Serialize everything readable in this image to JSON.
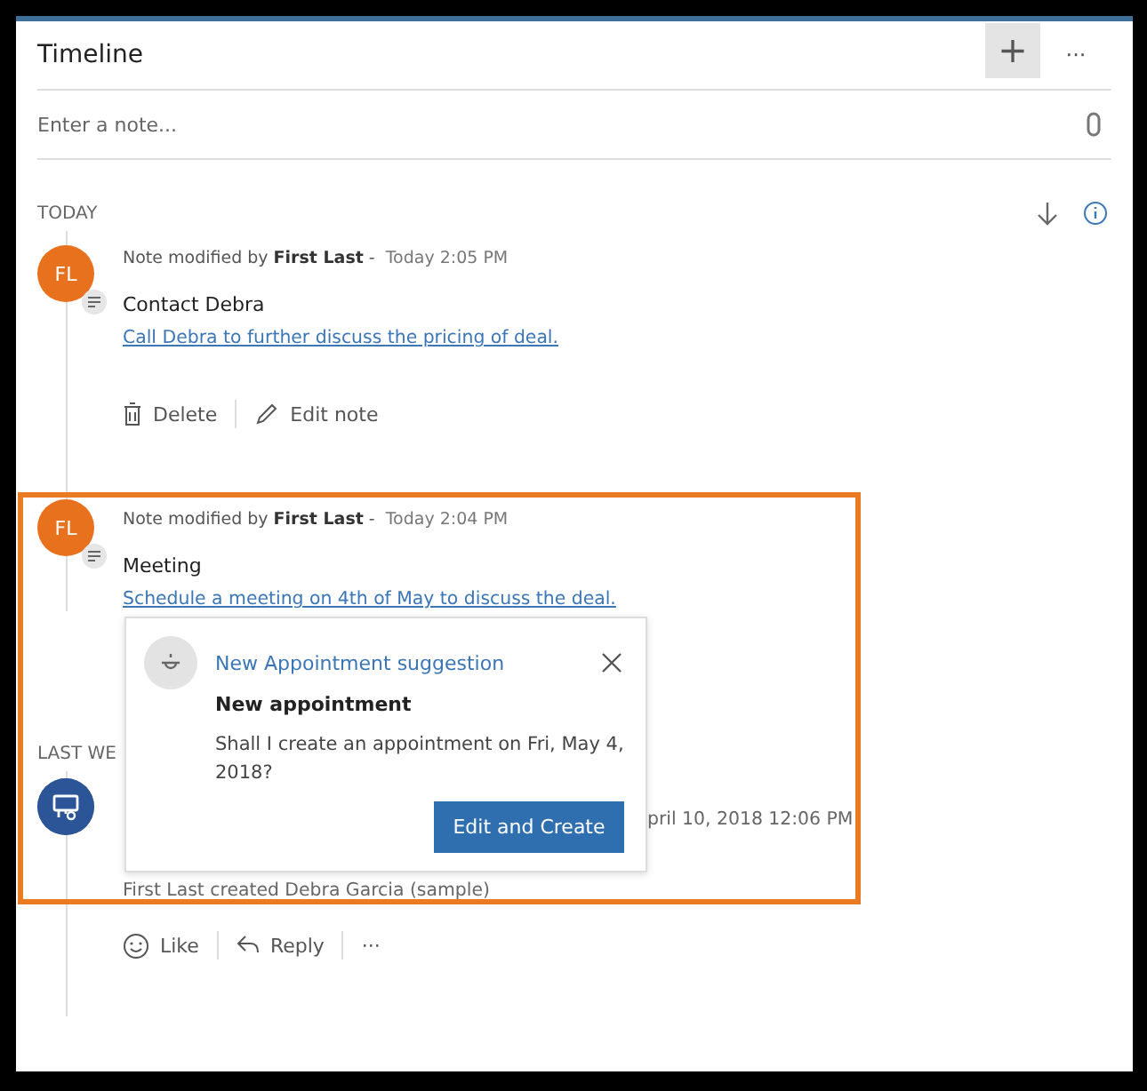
{
  "panel": {
    "title": "Timeline",
    "add_label": "+",
    "more_label": "···"
  },
  "note_field": {
    "placeholder": "Enter a note..."
  },
  "groups": [
    {
      "label": "TODAY",
      "entries": [
        {
          "kind": "note",
          "avatar": "FL",
          "header": "Note modified by **First Last** -",
          "time": "Today 2:05 PM",
          "title": "Contact Debra",
          "body": "Call Debra to further discuss the pricing of deal.",
          "actions": [
            {
              "kind": "delete",
              "label": "Delete"
            },
            {
              "kind": "edit",
              "label": "Edit note"
            }
          ]
        },
        {
          "kind": "note",
          "avatar": "FL",
          "header": "Note modified by **First Last** -",
          "time": "Today 2:04 PM",
          "title": "Meeting",
          "body": "Schedule a meeting on 4th of May to discuss the deal."
        }
      ]
    },
    {
      "label": "LAST WE",
      "entries": [
        {
          "kind": "record",
          "time": "pril 10, 2018 12:06 PM",
          "body": "First Last created Debra Garcia (sample)",
          "actions": [
            {
              "kind": "like",
              "label": "Like"
            },
            {
              "kind": "reply",
              "label": "Reply"
            },
            {
              "kind": "more",
              "label": "···"
            }
          ]
        }
      ]
    }
  ],
  "suggestion": {
    "title": "New Appointment suggestion",
    "heading": "New appointment",
    "text": "Shall I create an appointment on Fri, May 4, 2018?",
    "button": "Edit and Create"
  }
}
